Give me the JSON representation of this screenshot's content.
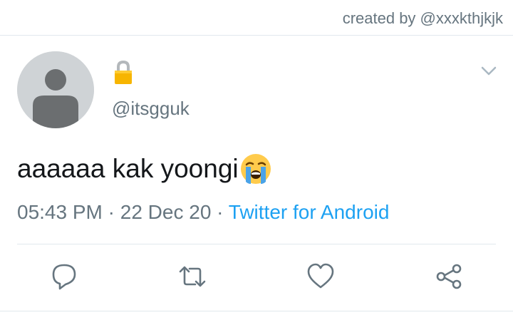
{
  "credit": "created by @xxxkthjkjk",
  "tweet": {
    "handle": "@itsgguk",
    "text": "aaaaaa kak yoongi",
    "time": "05:43 PM",
    "separator": " · ",
    "date": "22 Dec 20",
    "source": "Twitter for Android"
  },
  "icons": {
    "lock": "lock-icon",
    "emoji": "loudly-crying-face-emoji",
    "chevron": "chevron-down-icon",
    "reply": "reply-icon",
    "retweet": "retweet-icon",
    "like": "heart-icon",
    "share": "share-icon"
  },
  "colors": {
    "accent": "#1da1f2",
    "secondary_text": "#66757f",
    "primary_text": "#14171a",
    "divider": "#e1e8ed"
  }
}
